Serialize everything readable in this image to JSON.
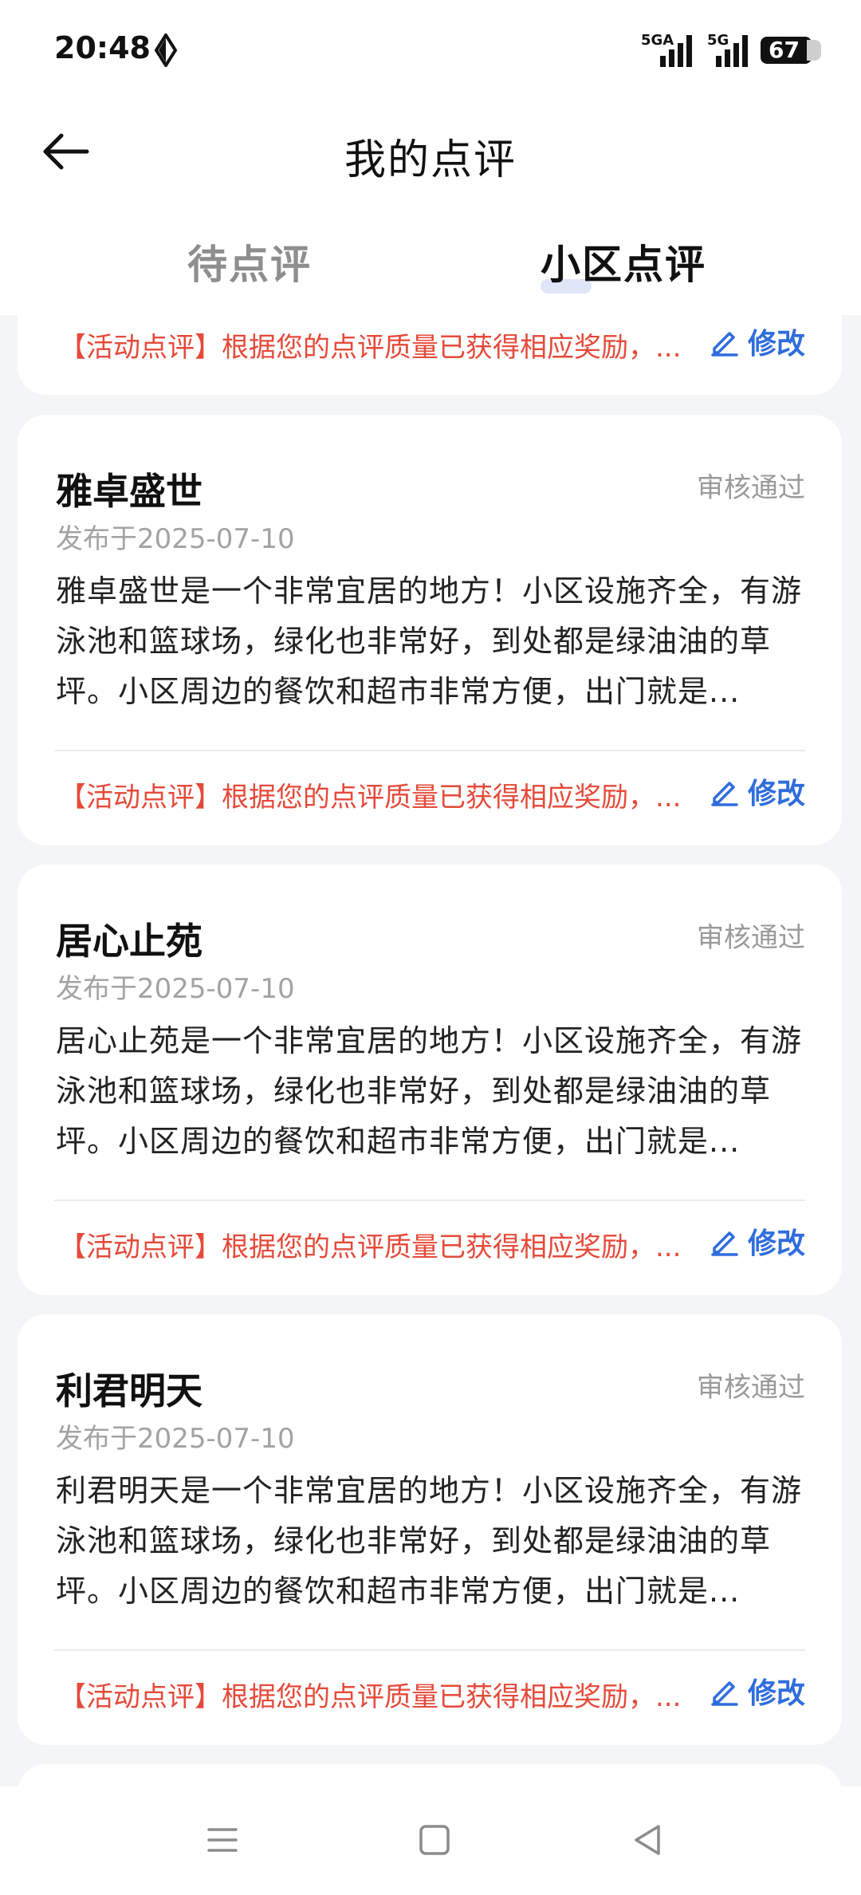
{
  "status_bar": {
    "time": "20:48",
    "signal1_label": "5GA",
    "signal2_label": "5G",
    "battery": "67"
  },
  "header": {
    "title": "我的点评"
  },
  "tabs": [
    {
      "label": "待点评",
      "active": false
    },
    {
      "label": "小区点评",
      "active": true
    }
  ],
  "partial_card": {
    "reward": "【活动点评】根据您的点评质量已获得相应奖励，...",
    "edit_label": "修改"
  },
  "reviews": [
    {
      "name": "雅卓盛世",
      "status": "审核通过",
      "date": "发布于2025-07-10",
      "content": "雅卓盛世是一个非常宜居的地方！小区设施齐全，有游泳池和篮球场，绿化也非常好，到处都是绿油油的草坪。小区周边的餐饮和超市非常方便，出门就是...",
      "reward": "【活动点评】根据您的点评质量已获得相应奖励，...",
      "edit_label": "修改"
    },
    {
      "name": "居心止苑",
      "status": "审核通过",
      "date": "发布于2025-07-10",
      "content": "居心止苑是一个非常宜居的地方！小区设施齐全，有游泳池和篮球场，绿化也非常好，到处都是绿油油的草坪。小区周边的餐饮和超市非常方便，出门就是...",
      "reward": "【活动点评】根据您的点评质量已获得相应奖励，...",
      "edit_label": "修改"
    },
    {
      "name": "利君明天",
      "status": "审核通过",
      "date": "发布于2025-07-10",
      "content": "利君明天是一个非常宜居的地方！小区设施齐全，有游泳池和篮球场，绿化也非常好，到处都是绿油油的草坪。小区周边的餐饮和超市非常方便，出门就是...",
      "reward": "【活动点评】根据您的点评质量已获得相应奖励，...",
      "edit_label": "修改"
    }
  ],
  "colors": {
    "accent": "#2f6ddc",
    "reward_red": "#e54a3a",
    "background": "#f4f5f7"
  },
  "icons": [
    "back-arrow-icon",
    "edit-pencil-icon",
    "menu-icon",
    "home-square-icon",
    "back-triangle-icon"
  ]
}
